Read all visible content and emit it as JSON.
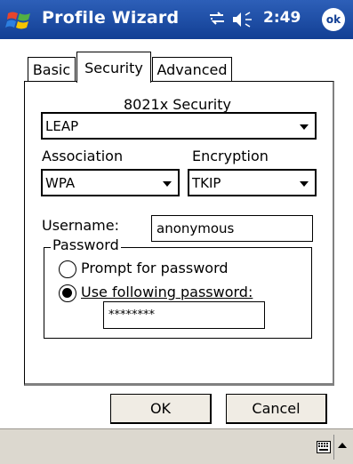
{
  "titlebar": {
    "title": "Profile Wizard",
    "time": "2:49",
    "ok_label": "ok",
    "icons": [
      "windows-flag-icon",
      "connectivity-icon",
      "volume-icon"
    ]
  },
  "tabs": [
    {
      "label": "Basic",
      "active": false
    },
    {
      "label": "Security",
      "active": true
    },
    {
      "label": "Advanced",
      "active": false
    }
  ],
  "security": {
    "heading": "8021x Security",
    "security_value": "LEAP",
    "association_label": "Association",
    "association_value": "WPA",
    "encryption_label": "Encryption",
    "encryption_value": "TKIP",
    "username_label": "Username:",
    "username_value": "anonymous",
    "password_group_label": "Password",
    "prompt_label": "Prompt for password",
    "use_label": "Use following password:",
    "password_value": "********",
    "selected_option": "use_following_password"
  },
  "buttons": {
    "ok": "OK",
    "cancel": "Cancel"
  },
  "colors": {
    "titlebar": "#1a4aa3",
    "bottombar": "#dcd8cf"
  }
}
